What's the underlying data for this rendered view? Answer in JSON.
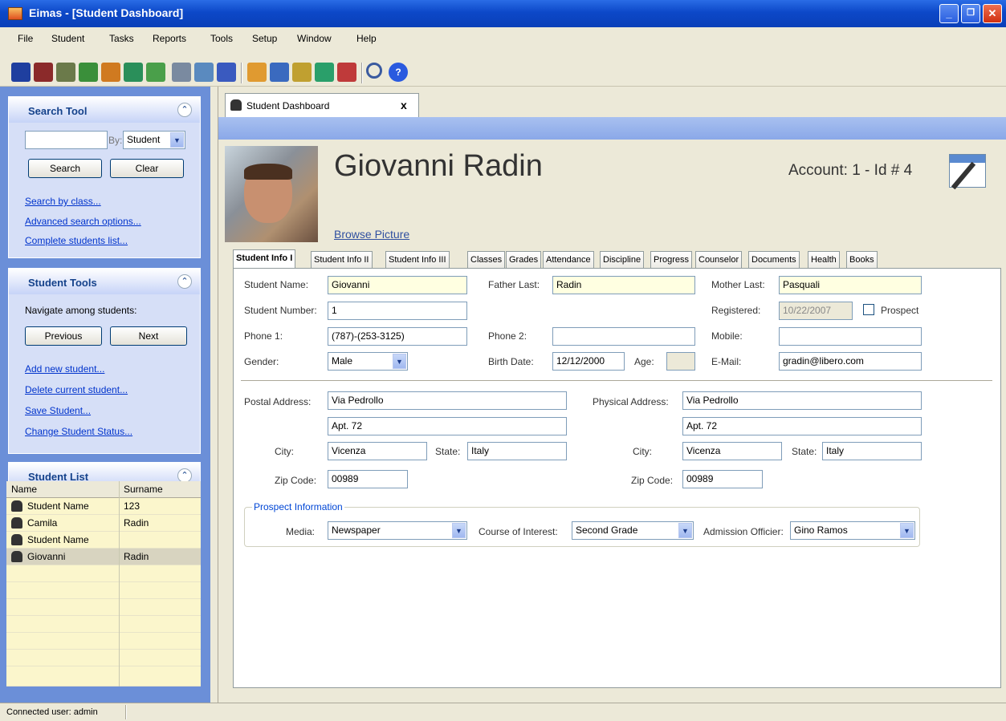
{
  "window": {
    "title": "Eimas - [Student Dashboard]",
    "min": "_",
    "max": "❐",
    "close": "✕"
  },
  "menu": [
    "File",
    "Student",
    "Tasks",
    "Reports",
    "Tools",
    "Setup",
    "Window",
    "Help"
  ],
  "search_tool": {
    "title": "Search Tool",
    "by_label": "By:",
    "by_value": "Student",
    "search_btn": "Search",
    "clear_btn": "Clear",
    "links": [
      "Search by class...",
      "Advanced search options...",
      "Complete students list..."
    ]
  },
  "student_tools": {
    "title": "Student Tools",
    "nav_label": "Navigate among students:",
    "prev_btn": "Previous",
    "next_btn": "Next",
    "links": [
      "Add new student...",
      "Delete current student...",
      "Save Student...",
      "Change Student Status..."
    ]
  },
  "student_list": {
    "title": "Student List",
    "columns": [
      "Name",
      "Surname"
    ],
    "rows": [
      [
        "Student Name",
        "123"
      ],
      [
        "Camila",
        "Radin"
      ],
      [
        "Student Name",
        ""
      ],
      [
        "Giovanni",
        "Radin"
      ]
    ]
  },
  "doc_tab": {
    "label": "Student Dashboard",
    "close": "x"
  },
  "student": {
    "name": "Giovanni Radin",
    "account": "Account: 1 - Id # 4",
    "browse": "Browse Picture"
  },
  "tabs": [
    "Student Info I",
    "Student Info II",
    "Student Info III",
    "Classes",
    "Grades",
    "Attendance",
    "Discipline",
    "Progress",
    "Counselor",
    "Documents",
    "Health",
    "Books"
  ],
  "form": {
    "student_name_label": "Student Name:",
    "student_name": "Giovanni",
    "father_last_label": "Father Last:",
    "father_last": "Radin",
    "mother_last_label": "Mother Last:",
    "mother_last": "Pasquali",
    "student_number_label": "Student Number:",
    "student_number": "1",
    "registered_label": "Registered:",
    "registered": "10/22/2007",
    "prospect_label": "Prospect",
    "phone1_label": "Phone 1:",
    "phone1": "(787)-(253-3125)",
    "phone2_label": "Phone 2:",
    "phone2": "",
    "mobile_label": "Mobile:",
    "mobile": "",
    "gender_label": "Gender:",
    "gender": "Male",
    "birth_label": "Birth Date:",
    "birth": "12/12/2000",
    "age_label": "Age:",
    "age": "",
    "email_label": "E-Mail:",
    "email": "gradin@libero.com",
    "postal_label": "Postal Address:",
    "postal1": "Via Pedrollo",
    "postal2": "Apt. 72",
    "physical_label": "Physical Address:",
    "physical1": "Via Pedrollo",
    "physical2": "Apt. 72",
    "city_label": "City:",
    "city": "Vicenza",
    "state_label": "State:",
    "state": "Italy",
    "city2": "Vicenza",
    "state2": "Italy",
    "zip_label": "Zip Code:",
    "zip": "00989",
    "zip2": "00989",
    "prospect_group": "Prospect Information",
    "media_label": "Media:",
    "media": "Newspaper",
    "course_label": "Course of Interest:",
    "course": "Second Grade",
    "officer_label": "Admission Officier:",
    "officer": "Gino Ramos"
  },
  "status": "Connected user: admin"
}
